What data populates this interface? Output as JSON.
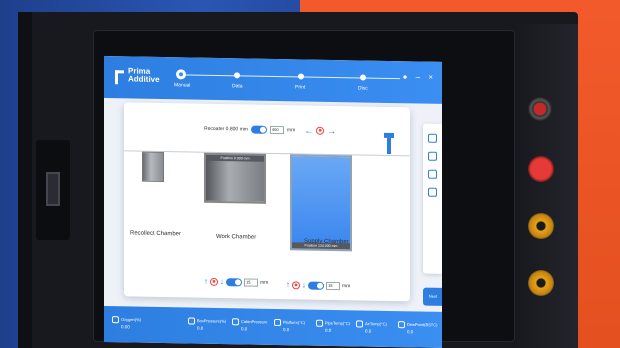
{
  "app": {
    "logo_line1": "Prima",
    "logo_line2": "Additive"
  },
  "steps": [
    {
      "label": "Manual",
      "active": true
    },
    {
      "label": "Data",
      "active": false
    },
    {
      "label": "Print",
      "active": false
    },
    {
      "label": "Disc",
      "active": false
    }
  ],
  "window_controls": "● – ×",
  "recoater": {
    "label": "Recoater 0.800 mm",
    "value": "400",
    "unit": "mm"
  },
  "chambers": {
    "recollect": {
      "name": "Recollect Chamber"
    },
    "work": {
      "name": "Work Chamber",
      "position": "Position 0.000 mm"
    },
    "supply": {
      "name": "Supply Chamber",
      "position": "Position 134.000 mm"
    }
  },
  "work_controls": {
    "value": "15",
    "unit": "mm"
  },
  "supply_controls": {
    "value": "15",
    "unit": "mm"
  },
  "next_button": "Next",
  "footer_stats": [
    {
      "label": "Oxygen(%)",
      "value": "0.00"
    },
    {
      "label": "",
      "value": ""
    },
    {
      "label": "BoxPressure(%)",
      "value": "0.0"
    },
    {
      "label": "CabinPressure",
      "value": "0.0"
    },
    {
      "label": "Platform(°C)",
      "value": "0.0"
    },
    {
      "label": "PipeTemp(°C)",
      "value": "0.0"
    },
    {
      "label": "AirTemp(°C)",
      "value": "0.0"
    },
    {
      "label": "DewPoint(BSTC)",
      "value": "0.0"
    }
  ],
  "colors": {
    "accent": "#2d7ee0",
    "panel_bg": "#eef2f8",
    "supply_fill": "#3a86ef"
  }
}
